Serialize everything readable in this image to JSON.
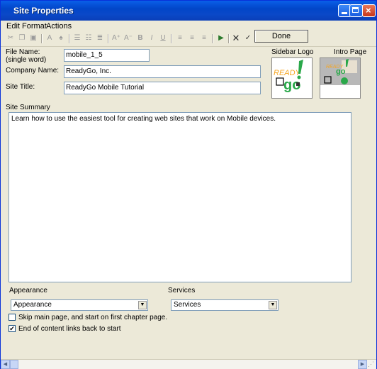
{
  "window": {
    "title": "Site Properties"
  },
  "menu": [
    "Edit",
    "Format",
    "Actions"
  ],
  "toolbar": {
    "done_label": "Done"
  },
  "form": {
    "file_name_label": "File Name:",
    "file_name_hint": "(single word)",
    "file_name_value": "mobile_1_5",
    "company_label": "Company Name:",
    "company_value": "ReadyGo, Inc.",
    "site_title_label": "Site Title:",
    "site_title_value": "ReadyGo Mobile Tutorial",
    "sidebar_logo_label": "Sidebar Logo",
    "intro_page_label": "Intro Page",
    "logo_text_ready": "READY",
    "logo_text_go": "go",
    "summary_label": "Site Summary",
    "summary_value": "Learn how to use the easiest tool for creating web sites that work on Mobile devices.",
    "appearance_label": "Appearance",
    "appearance_selected": "Appearance",
    "services_label": "Services",
    "services_selected": "Services",
    "skip_main_label": "Skip main page, and start on first chapter page.",
    "skip_main_checked": false,
    "end_links_label": "End of content links back to start",
    "end_links_checked": true
  },
  "colors": {
    "title_blue": "#0246c8",
    "logo_orange": "#f5a623",
    "logo_green": "#2aa84a"
  }
}
